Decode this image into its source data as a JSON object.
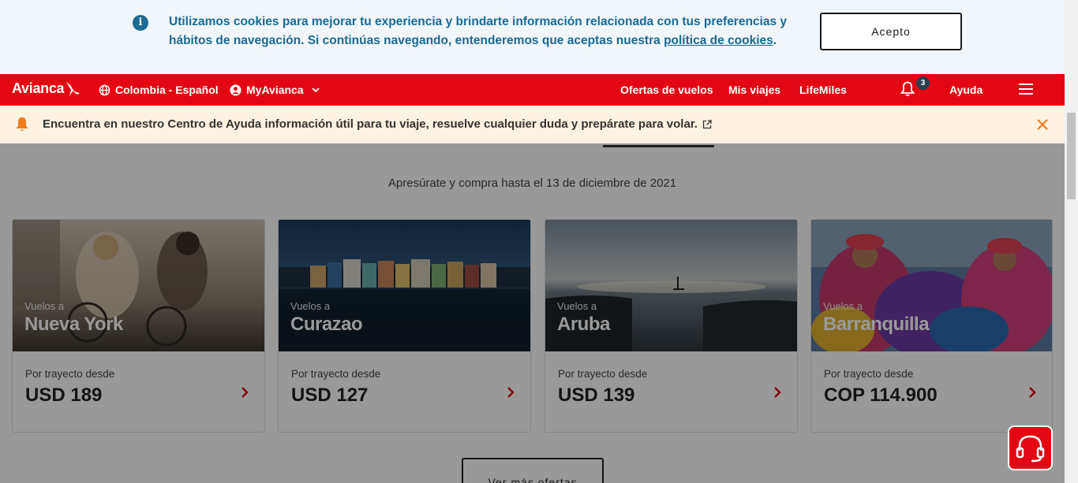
{
  "cookie_banner": {
    "text_before_link": "Utilizamos cookies para mejorar tu experiencia y brindarte información relacionada con tus preferencias y hábitos de navegación. Si continúas navegando, entenderemos que aceptas nuestra ",
    "link_text": "política de cookies",
    "text_after_link": ".",
    "accept_label": "Acepto",
    "info_icon": "i"
  },
  "nav": {
    "logo": "Avianca",
    "region": "Colombia - Español",
    "account": "MyAvianca",
    "links": [
      "Ofertas de vuelos",
      "Mis viajes",
      "LifeMiles"
    ],
    "notification_count": "3",
    "help": "Ayuda"
  },
  "notice": {
    "text": "Encuentra en nuestro Centro de Ayuda información útil para tu viaje, resuelve cualquier duda y prepárate para volar."
  },
  "offers": {
    "deadline": "Apresúrate y compra hasta el 13 de diciembre de 2021",
    "cards": [
      {
        "subtitle": "Vuelos a",
        "city": "Nueva York",
        "from": "Por trayecto desde",
        "price": "USD 189"
      },
      {
        "subtitle": "Vuelos a",
        "city": "Curazao",
        "from": "Por trayecto desde",
        "price": "USD 127"
      },
      {
        "subtitle": "Vuelos a",
        "city": "Aruba",
        "from": "Por trayecto desde",
        "price": "USD 139"
      },
      {
        "subtitle": "Vuelos a",
        "city": "Barranquilla",
        "from": "Por trayecto desde",
        "price": "COP 114.900"
      }
    ],
    "more_label": "Ver más ofertas"
  },
  "colors": {
    "brand_red": "#e30613",
    "cookie_blue": "#1b6a93",
    "notice_bg": "#fdf1e0"
  }
}
